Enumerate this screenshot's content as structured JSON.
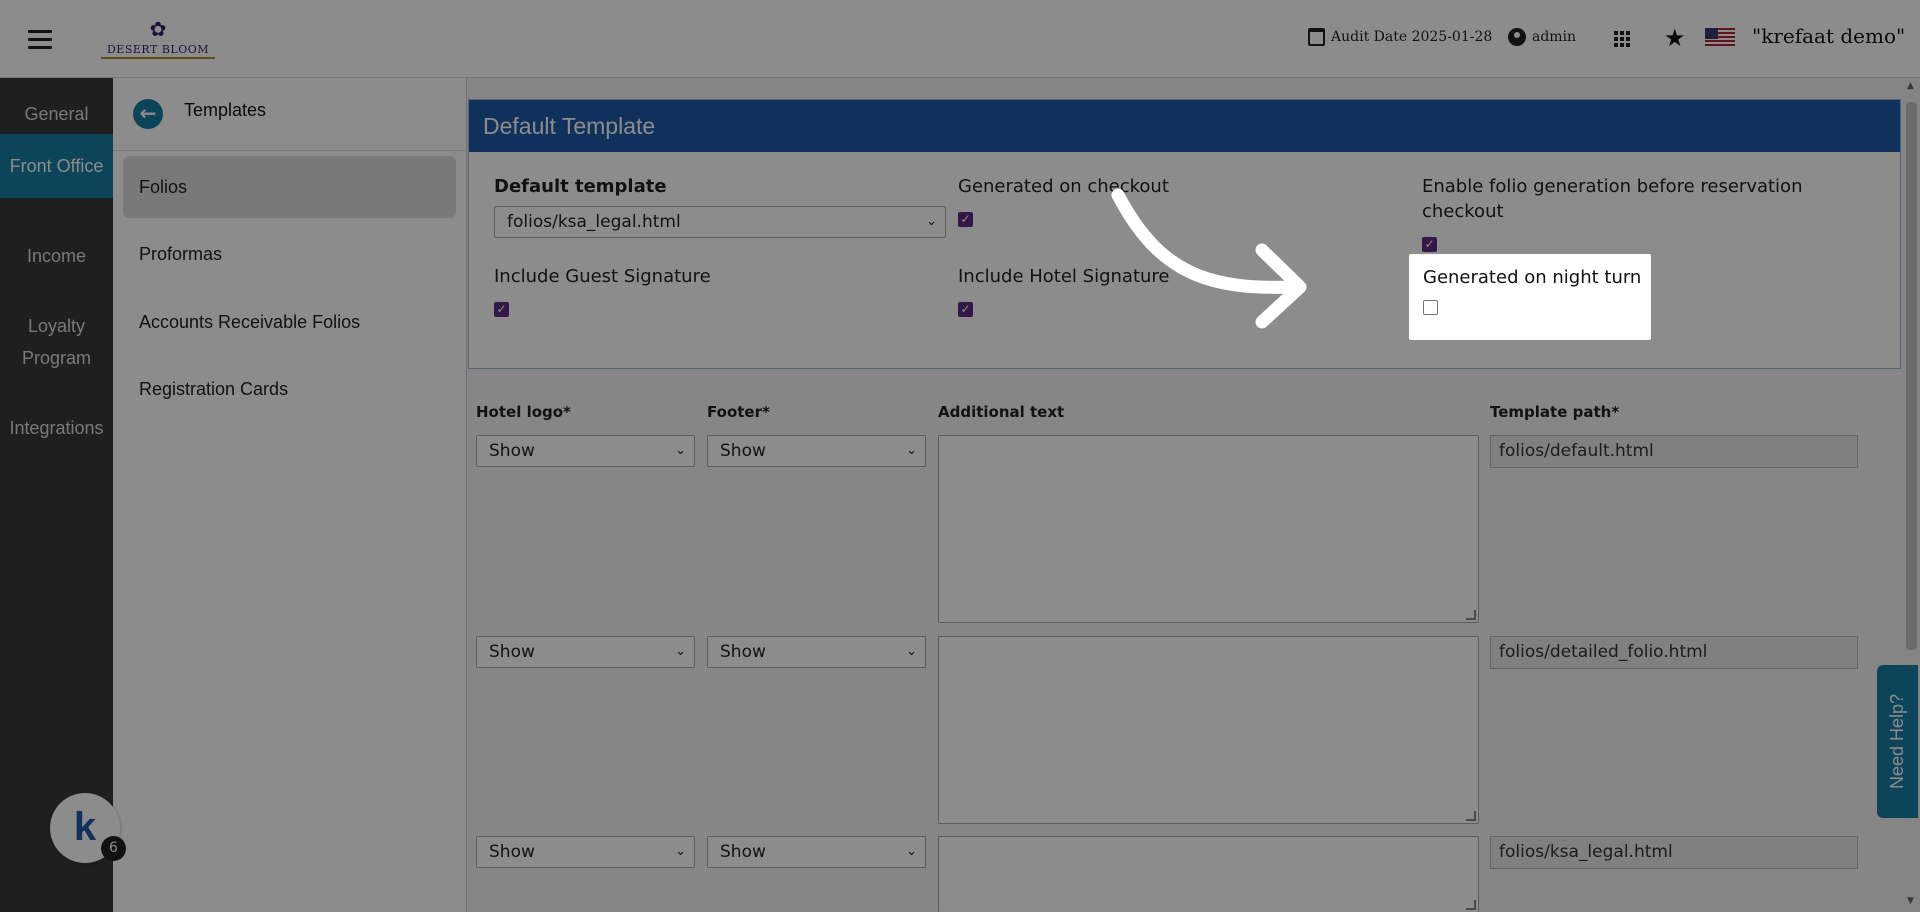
{
  "header": {
    "brand": "DESERT BLOOM",
    "audit_date": "Audit Date 2025-01-28",
    "user": "admin",
    "company": "\"krefaat demo\""
  },
  "left_nav": {
    "items": [
      {
        "label": "General"
      },
      {
        "label": "Front Office",
        "active": true
      },
      {
        "label": "Income"
      },
      {
        "label": "Loyalty Program"
      },
      {
        "label": "Integrations"
      }
    ]
  },
  "sub_nav": {
    "title": "Templates",
    "items": [
      {
        "label": "Folios",
        "active": true
      },
      {
        "label": "Proformas"
      },
      {
        "label": "Accounts Receivable Folios"
      },
      {
        "label": "Registration Cards"
      }
    ]
  },
  "panel": {
    "title": "Default Template",
    "default_template_label": "Default template",
    "default_template_value": "folios/ksa_legal.html",
    "generated_on_checkout_label": "Generated on checkout",
    "generated_on_checkout": true,
    "enable_folio_label": "Enable folio generation before reservation checkout",
    "enable_folio": true,
    "guest_signature_label": "Include Guest Signature",
    "guest_signature": true,
    "hotel_signature_label": "Include Hotel Signature",
    "hotel_signature": true,
    "night_turn_label": "Generated on night turn",
    "night_turn": false
  },
  "table": {
    "headers": {
      "logo": "Hotel logo*",
      "footer": "Footer*",
      "additional": "Additional text",
      "path": "Template path*"
    },
    "rows": [
      {
        "logo": "Show",
        "footer": "Show",
        "additional": "",
        "path": "folios/default.html"
      },
      {
        "logo": "Show",
        "footer": "Show",
        "additional": "",
        "path": "folios/detailed_folio.html"
      },
      {
        "logo": "Show",
        "footer": "Show",
        "additional": "",
        "path": "folios/ksa_legal.html"
      }
    ]
  },
  "help": {
    "label": "Need Help?"
  },
  "badge": {
    "letter": "k",
    "count": "6"
  },
  "colors": {
    "accent": "#167fa3",
    "panel_header": "#1c5aa6",
    "checkbox": "#5a2d82"
  }
}
